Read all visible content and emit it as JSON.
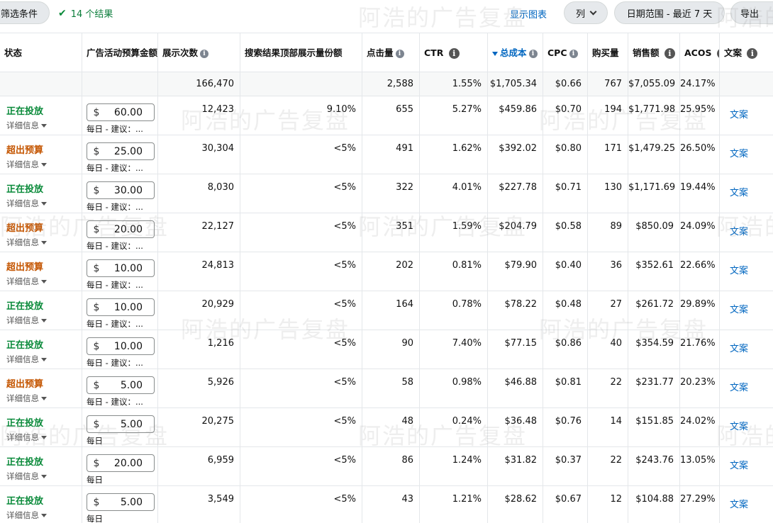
{
  "toolbar": {
    "filter_label": "筛选条件",
    "result_text": "14 个结果",
    "chart_link": "显示图表",
    "columns_label": "列",
    "date_range_label": "日期范围 - 最近 7 天",
    "export_label": "导出"
  },
  "headers": {
    "status": "状态",
    "budget": "广告活动预算金额",
    "impressions": "展示次数",
    "top_share": "搜索结果顶部展示量份额",
    "clicks": "点击量",
    "ctr": "CTR",
    "cost": "总成本",
    "cpc": "CPC",
    "orders": "购买量",
    "sales": "销售额",
    "acos": "ACOS",
    "ad": "文案"
  },
  "summary": {
    "impressions": "166,470",
    "clicks": "2,588",
    "ctr": "1.55%",
    "cost": "$1,705.34",
    "cpc": "$0.66",
    "orders": "767",
    "sales": "$7,055.09",
    "acos": "24.17%"
  },
  "common": {
    "detail": "详细信息",
    "currency": "$",
    "ad_link": "文案"
  },
  "rows": [
    {
      "status": "正在投放",
      "status_type": "on",
      "budget": "60.00",
      "budget_sub": "每日 - 建议：...",
      "impressions": "12,423",
      "top_share": "9.10%",
      "clicks": "655",
      "ctr": "5.27%",
      "cost": "$459.86",
      "cpc": "$0.70",
      "orders": "194",
      "sales": "$1,771.98",
      "acos": "25.95%"
    },
    {
      "status": "超出预算",
      "status_type": "over",
      "budget": "25.00",
      "budget_sub": "每日 - 建议：...",
      "impressions": "30,304",
      "top_share": "<5%",
      "clicks": "491",
      "ctr": "1.62%",
      "cost": "$392.02",
      "cpc": "$0.80",
      "orders": "171",
      "sales": "$1,479.25",
      "acos": "26.50%"
    },
    {
      "status": "正在投放",
      "status_type": "on",
      "budget": "30.00",
      "budget_sub": "每日 - 建议：...",
      "impressions": "8,030",
      "top_share": "<5%",
      "clicks": "322",
      "ctr": "4.01%",
      "cost": "$227.78",
      "cpc": "$0.71",
      "orders": "130",
      "sales": "$1,171.69",
      "acos": "19.44%"
    },
    {
      "status": "超出预算",
      "status_type": "over",
      "budget": "20.00",
      "budget_sub": "每日 - 建议：...",
      "impressions": "22,127",
      "top_share": "<5%",
      "clicks": "351",
      "ctr": "1.59%",
      "cost": "$204.79",
      "cpc": "$0.58",
      "orders": "89",
      "sales": "$850.09",
      "acos": "24.09%"
    },
    {
      "status": "超出预算",
      "status_type": "over",
      "budget": "10.00",
      "budget_sub": "每日 - 建议：...",
      "impressions": "24,813",
      "top_share": "<5%",
      "clicks": "202",
      "ctr": "0.81%",
      "cost": "$79.90",
      "cpc": "$0.40",
      "orders": "36",
      "sales": "$352.61",
      "acos": "22.66%"
    },
    {
      "status": "正在投放",
      "status_type": "on",
      "budget": "10.00",
      "budget_sub": "每日 - 建议：...",
      "impressions": "20,929",
      "top_share": "<5%",
      "clicks": "164",
      "ctr": "0.78%",
      "cost": "$78.22",
      "cpc": "$0.48",
      "orders": "27",
      "sales": "$261.72",
      "acos": "29.89%"
    },
    {
      "status": "正在投放",
      "status_type": "on",
      "budget": "10.00",
      "budget_sub": "每日 - 建议：...",
      "impressions": "1,216",
      "top_share": "<5%",
      "clicks": "90",
      "ctr": "7.40%",
      "cost": "$77.15",
      "cpc": "$0.86",
      "orders": "40",
      "sales": "$354.59",
      "acos": "21.76%"
    },
    {
      "status": "超出预算",
      "status_type": "over",
      "budget": "5.00",
      "budget_sub": "每日 - 建议：...",
      "impressions": "5,926",
      "top_share": "<5%",
      "clicks": "58",
      "ctr": "0.98%",
      "cost": "$46.88",
      "cpc": "$0.81",
      "orders": "22",
      "sales": "$231.77",
      "acos": "20.23%"
    },
    {
      "status": "正在投放",
      "status_type": "on",
      "budget": "5.00",
      "budget_sub": "每日",
      "impressions": "20,275",
      "top_share": "<5%",
      "clicks": "48",
      "ctr": "0.24%",
      "cost": "$36.48",
      "cpc": "$0.76",
      "orders": "14",
      "sales": "$151.85",
      "acos": "24.02%"
    },
    {
      "status": "正在投放",
      "status_type": "on",
      "budget": "20.00",
      "budget_sub": "每日",
      "impressions": "6,959",
      "top_share": "<5%",
      "clicks": "86",
      "ctr": "1.24%",
      "cost": "$31.82",
      "cpc": "$0.37",
      "orders": "22",
      "sales": "$243.76",
      "acos": "13.05%"
    },
    {
      "status": "正在投放",
      "status_type": "on",
      "budget": "5.00",
      "budget_sub": "每日",
      "impressions": "3,549",
      "top_share": "<5%",
      "clicks": "43",
      "ctr": "1.21%",
      "cost": "$28.62",
      "cpc": "$0.67",
      "orders": "12",
      "sales": "$104.88",
      "acos": "27.29%"
    }
  ],
  "watermark": "阿浩的广告复盘",
  "colors": {
    "status_on": "#0a8a3a",
    "status_over": "#c45500",
    "link": "#0066c0"
  }
}
